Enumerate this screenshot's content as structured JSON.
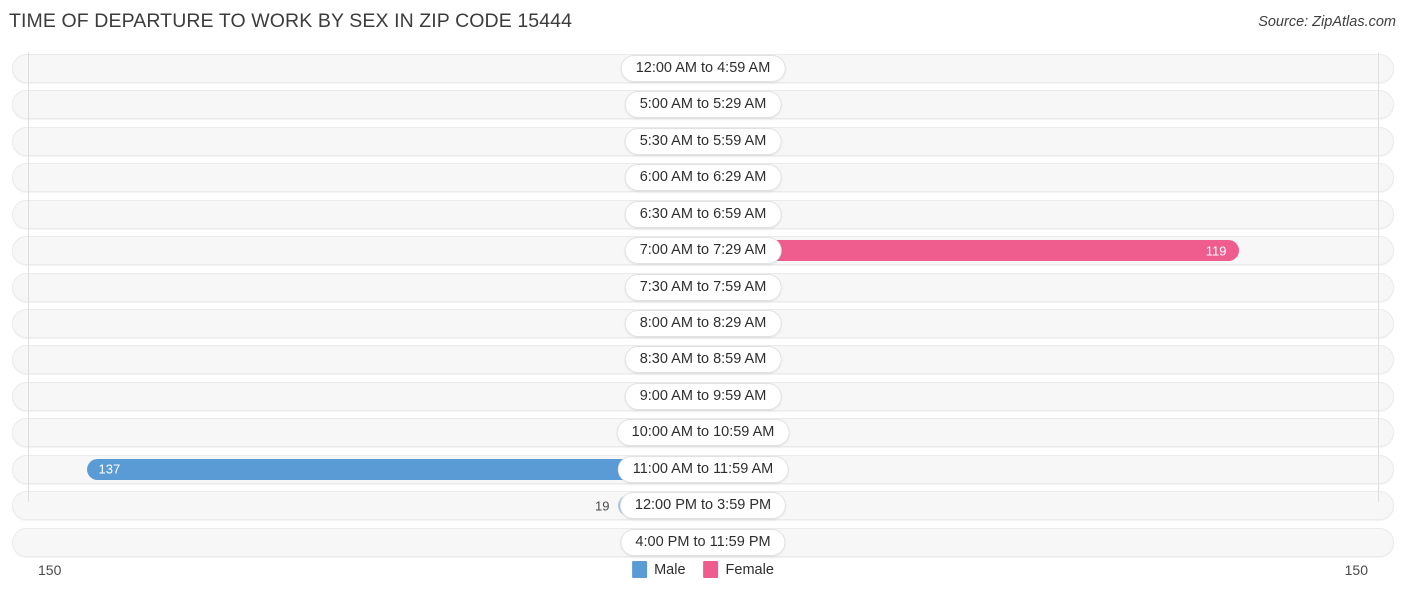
{
  "header": {
    "title": "TIME OF DEPARTURE TO WORK BY SEX IN ZIP CODE 15444",
    "source": "Source: ZipAtlas.com"
  },
  "legend": {
    "male_label": "Male",
    "female_label": "Female",
    "male_color": "#5b9bd5",
    "female_color": "#ee5d8d"
  },
  "axis": {
    "left_max": "150",
    "right_max": "150"
  },
  "chart_data": {
    "type": "bar",
    "orientation": "horizontal",
    "style": "diverging-bidirectional",
    "title": "TIME OF DEPARTURE TO WORK BY SEX IN ZIP CODE 15444",
    "xlabel": "",
    "ylabel": "",
    "xlim": [
      -150,
      150
    ],
    "axis_max": 150,
    "grid": false,
    "legend_position": "bottom-center",
    "categories": [
      "12:00 AM to 4:59 AM",
      "5:00 AM to 5:29 AM",
      "5:30 AM to 5:59 AM",
      "6:00 AM to 6:29 AM",
      "6:30 AM to 6:59 AM",
      "7:00 AM to 7:29 AM",
      "7:30 AM to 7:59 AM",
      "8:00 AM to 8:29 AM",
      "8:30 AM to 8:59 AM",
      "9:00 AM to 9:59 AM",
      "10:00 AM to 10:59 AM",
      "11:00 AM to 11:59 AM",
      "12:00 PM to 3:59 PM",
      "4:00 PM to 11:59 PM"
    ],
    "series": [
      {
        "name": "Male",
        "color": "#5b9bd5",
        "direction": "left",
        "values": [
          0,
          0,
          0,
          0,
          0,
          0,
          0,
          0,
          0,
          0,
          0,
          137,
          19,
          0
        ]
      },
      {
        "name": "Female",
        "color": "#ee5d8d",
        "direction": "right",
        "values": [
          0,
          0,
          0,
          0,
          0,
          119,
          0,
          0,
          0,
          0,
          0,
          0,
          0,
          0
        ]
      }
    ]
  },
  "rows": [
    {
      "label": "12:00 AM to 4:59 AM",
      "male": "0",
      "female": "0"
    },
    {
      "label": "5:00 AM to 5:29 AM",
      "male": "0",
      "female": "0"
    },
    {
      "label": "5:30 AM to 5:59 AM",
      "male": "0",
      "female": "0"
    },
    {
      "label": "6:00 AM to 6:29 AM",
      "male": "0",
      "female": "0"
    },
    {
      "label": "6:30 AM to 6:59 AM",
      "male": "0",
      "female": "0"
    },
    {
      "label": "7:00 AM to 7:29 AM",
      "male": "0",
      "female": "119"
    },
    {
      "label": "7:30 AM to 7:59 AM",
      "male": "0",
      "female": "0"
    },
    {
      "label": "8:00 AM to 8:29 AM",
      "male": "0",
      "female": "0"
    },
    {
      "label": "8:30 AM to 8:59 AM",
      "male": "0",
      "female": "0"
    },
    {
      "label": "9:00 AM to 9:59 AM",
      "male": "0",
      "female": "0"
    },
    {
      "label": "10:00 AM to 10:59 AM",
      "male": "0",
      "female": "0"
    },
    {
      "label": "11:00 AM to 11:59 AM",
      "male": "137",
      "female": "0"
    },
    {
      "label": "12:00 PM to 3:59 PM",
      "male": "19",
      "female": "0"
    },
    {
      "label": "4:00 PM to 11:59 PM",
      "male": "0",
      "female": "0"
    }
  ]
}
